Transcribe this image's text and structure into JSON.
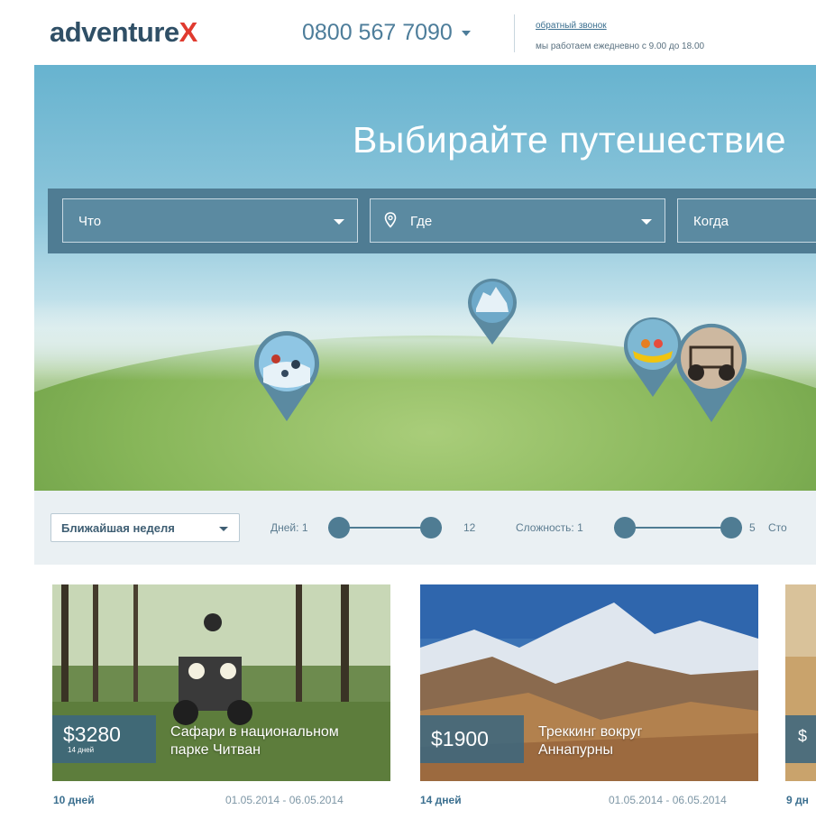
{
  "header": {
    "logo_main": "adventure",
    "logo_accent": "X",
    "phone": "0800 567 7090",
    "callback_link": "обратный звонок",
    "hours": "мы работаем ежедневно с 9.00 до 18.00"
  },
  "hero": {
    "title": "Выбирайте путешествие",
    "search": {
      "what": "Что",
      "where": "Где",
      "when": "Когда"
    }
  },
  "filters": {
    "period": "Ближайшая неделя",
    "days_label": "Дней:",
    "days_min": "1",
    "days_max": "12",
    "difficulty_label": "Сложность:",
    "difficulty_min": "1",
    "difficulty_max": "5",
    "cost_label_partial": "Сто"
  },
  "cards": [
    {
      "price": "$3280",
      "price_duration": "14 дней",
      "title_line1": "Сафари в национальном",
      "title_line2": "парке Читван",
      "days": "10 дней",
      "dates": "01.05.2014 - 06.05.2014"
    },
    {
      "price": "$1900",
      "title_line1": "Треккинг вокруг",
      "title_line2": "Аннапурны",
      "days": "14 дней",
      "dates": "01.05.2014 - 06.05.2014"
    },
    {
      "price_partial": "$",
      "days_partial": "9 дн"
    }
  ],
  "colors": {
    "brand_dark": "#2f4f66",
    "brand_accent": "#e03a2f",
    "slate": "#4f7c93"
  }
}
